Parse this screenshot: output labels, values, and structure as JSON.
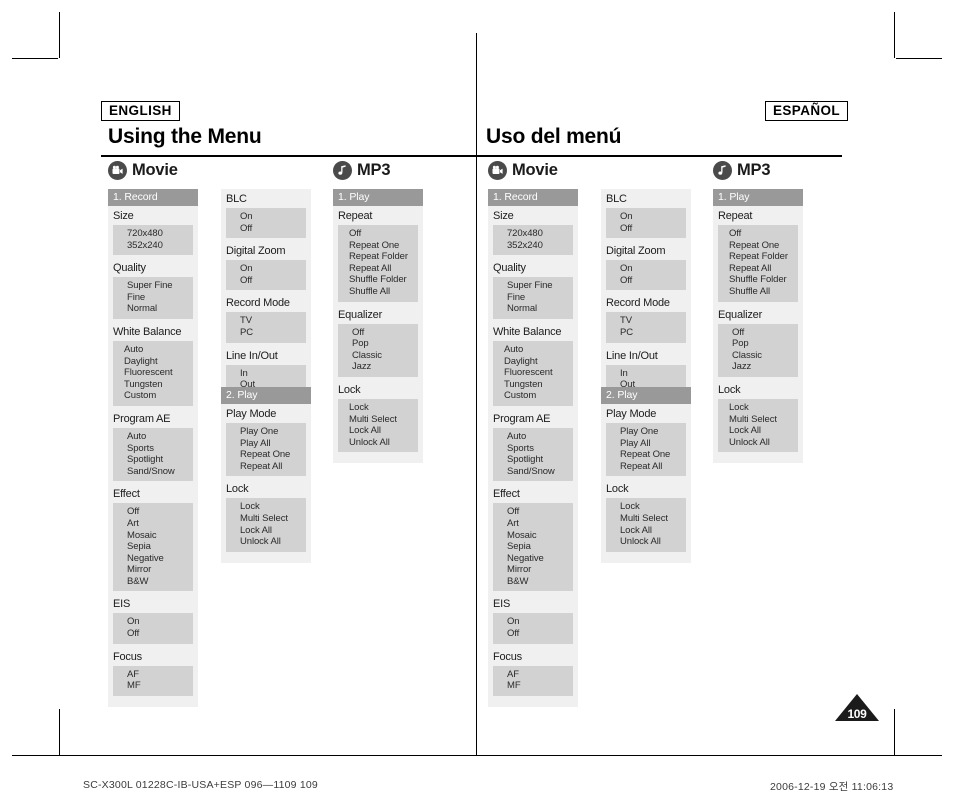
{
  "crop_marks": true,
  "left_page": {
    "language_tag": "ENGLISH",
    "title": "Using the Menu"
  },
  "right_page": {
    "language_tag": "ESPAÑOL",
    "title": "Uso del menú"
  },
  "sections": {
    "movie": {
      "label": "Movie",
      "icon": "movie-camera-icon"
    },
    "mp3": {
      "label": "MP3",
      "icon": "music-note-icon"
    }
  },
  "movie_col1": {
    "header": "1. Record",
    "groups": [
      {
        "title": "Size",
        "options": [
          "720x480",
          "352x240"
        ]
      },
      {
        "title": "Quality",
        "options": [
          "Super Fine",
          "Fine",
          "Normal"
        ]
      },
      {
        "title": "White Balance",
        "options": [
          "Auto",
          "Daylight",
          "Fluorescent",
          "Tungsten",
          "Custom"
        ]
      },
      {
        "title": "Program AE",
        "options": [
          "Auto",
          "Sports",
          "Spotlight",
          "Sand/Snow"
        ]
      },
      {
        "title": "Effect",
        "options": [
          "Off",
          "Art",
          "Mosaic",
          "Sepia",
          "Negative",
          "Mirror",
          "B&W"
        ]
      },
      {
        "title": "EIS",
        "options": [
          "On",
          "Off"
        ]
      },
      {
        "title": "Focus",
        "options": [
          "AF",
          "MF"
        ]
      }
    ]
  },
  "movie_col2": {
    "groups": [
      {
        "title": "BLC",
        "options": [
          "On",
          "Off"
        ]
      },
      {
        "title": "Digital Zoom",
        "options": [
          "On",
          "Off"
        ]
      },
      {
        "title": "Record Mode",
        "options": [
          "TV",
          "PC"
        ]
      },
      {
        "title": "Line In/Out",
        "options": [
          "In",
          "Out"
        ]
      }
    ],
    "header2": "2. Play",
    "groups2": [
      {
        "title": "Play Mode",
        "options": [
          "Play One",
          "Play All",
          "Repeat One",
          "Repeat All"
        ]
      },
      {
        "title": "Lock",
        "options": [
          "Lock",
          "Multi Select",
          "Lock All",
          "Unlock All"
        ]
      }
    ]
  },
  "mp3_col": {
    "header": "1. Play",
    "groups": [
      {
        "title": "Repeat",
        "options": [
          "Off",
          "Repeat One",
          "Repeat Folder",
          "Repeat All",
          "Shuffle Folder",
          "Shuffle All"
        ]
      },
      {
        "title": "Equalizer",
        "options": [
          "Off",
          "Pop",
          "Classic",
          "Jazz"
        ]
      },
      {
        "title": "Lock",
        "options": [
          "Lock",
          "Multi Select",
          "Lock All",
          "Unlock All"
        ]
      }
    ]
  },
  "page_number": "109",
  "footer": {
    "left": "SC-X300L 01228C-IB-USA+ESP 096—1109    109",
    "right": "2006-12-19    오전 11:06:13"
  },
  "colors": {
    "col_header_bg": "#999999",
    "col_bg": "#f0f0f0",
    "option_bg": "#d2d2d2",
    "text": "#1c1c1c",
    "badge_bg": "#1b1b1b"
  }
}
